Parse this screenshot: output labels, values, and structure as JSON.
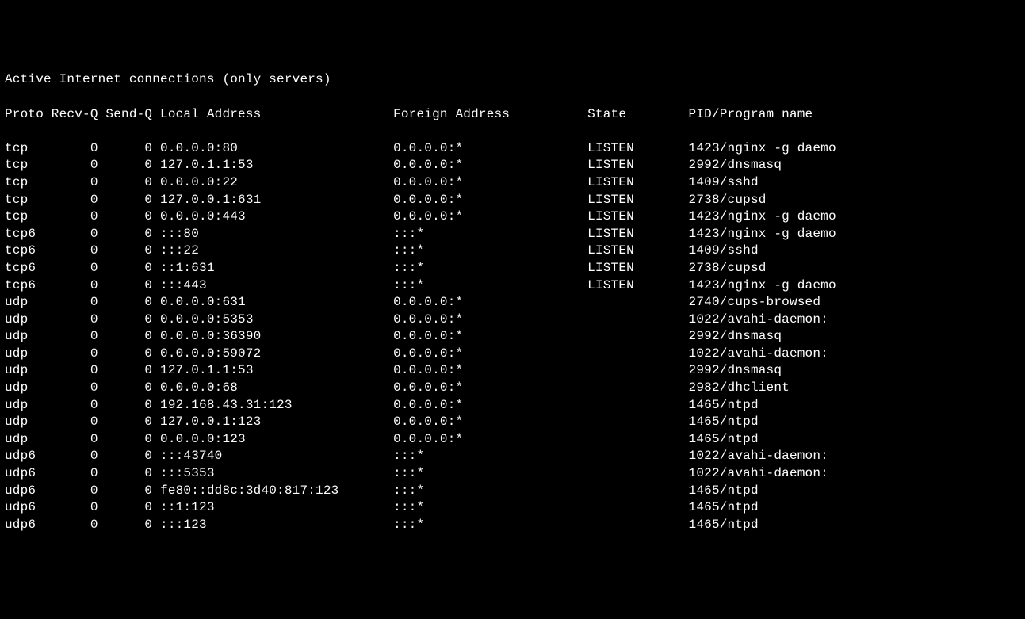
{
  "title": "Active Internet connections (only servers)",
  "headers": {
    "proto": "Proto",
    "recvq": "Recv-Q",
    "sendq": "Send-Q",
    "local": "Local Address",
    "foreign": "Foreign Address",
    "state": "State",
    "pid": "PID/Program name"
  },
  "rows": [
    {
      "proto": "tcp",
      "recvq": "0",
      "sendq": "0",
      "local": "0.0.0.0:80",
      "foreign": "0.0.0.0:*",
      "state": "LISTEN",
      "pid": "1423/nginx -g daemo"
    },
    {
      "proto": "tcp",
      "recvq": "0",
      "sendq": "0",
      "local": "127.0.1.1:53",
      "foreign": "0.0.0.0:*",
      "state": "LISTEN",
      "pid": "2992/dnsmasq"
    },
    {
      "proto": "tcp",
      "recvq": "0",
      "sendq": "0",
      "local": "0.0.0.0:22",
      "foreign": "0.0.0.0:*",
      "state": "LISTEN",
      "pid": "1409/sshd"
    },
    {
      "proto": "tcp",
      "recvq": "0",
      "sendq": "0",
      "local": "127.0.0.1:631",
      "foreign": "0.0.0.0:*",
      "state": "LISTEN",
      "pid": "2738/cupsd"
    },
    {
      "proto": "tcp",
      "recvq": "0",
      "sendq": "0",
      "local": "0.0.0.0:443",
      "foreign": "0.0.0.0:*",
      "state": "LISTEN",
      "pid": "1423/nginx -g daemo"
    },
    {
      "proto": "tcp6",
      "recvq": "0",
      "sendq": "0",
      "local": ":::80",
      "foreign": ":::*",
      "state": "LISTEN",
      "pid": "1423/nginx -g daemo"
    },
    {
      "proto": "tcp6",
      "recvq": "0",
      "sendq": "0",
      "local": ":::22",
      "foreign": ":::*",
      "state": "LISTEN",
      "pid": "1409/sshd"
    },
    {
      "proto": "tcp6",
      "recvq": "0",
      "sendq": "0",
      "local": "::1:631",
      "foreign": ":::*",
      "state": "LISTEN",
      "pid": "2738/cupsd"
    },
    {
      "proto": "tcp6",
      "recvq": "0",
      "sendq": "0",
      "local": ":::443",
      "foreign": ":::*",
      "state": "LISTEN",
      "pid": "1423/nginx -g daemo"
    },
    {
      "proto": "udp",
      "recvq": "0",
      "sendq": "0",
      "local": "0.0.0.0:631",
      "foreign": "0.0.0.0:*",
      "state": "",
      "pid": "2740/cups-browsed"
    },
    {
      "proto": "udp",
      "recvq": "0",
      "sendq": "0",
      "local": "0.0.0.0:5353",
      "foreign": "0.0.0.0:*",
      "state": "",
      "pid": "1022/avahi-daemon:"
    },
    {
      "proto": "udp",
      "recvq": "0",
      "sendq": "0",
      "local": "0.0.0.0:36390",
      "foreign": "0.0.0.0:*",
      "state": "",
      "pid": "2992/dnsmasq"
    },
    {
      "proto": "udp",
      "recvq": "0",
      "sendq": "0",
      "local": "0.0.0.0:59072",
      "foreign": "0.0.0.0:*",
      "state": "",
      "pid": "1022/avahi-daemon:"
    },
    {
      "proto": "udp",
      "recvq": "0",
      "sendq": "0",
      "local": "127.0.1.1:53",
      "foreign": "0.0.0.0:*",
      "state": "",
      "pid": "2992/dnsmasq"
    },
    {
      "proto": "udp",
      "recvq": "0",
      "sendq": "0",
      "local": "0.0.0.0:68",
      "foreign": "0.0.0.0:*",
      "state": "",
      "pid": "2982/dhclient"
    },
    {
      "proto": "udp",
      "recvq": "0",
      "sendq": "0",
      "local": "192.168.43.31:123",
      "foreign": "0.0.0.0:*",
      "state": "",
      "pid": "1465/ntpd"
    },
    {
      "proto": "udp",
      "recvq": "0",
      "sendq": "0",
      "local": "127.0.0.1:123",
      "foreign": "0.0.0.0:*",
      "state": "",
      "pid": "1465/ntpd"
    },
    {
      "proto": "udp",
      "recvq": "0",
      "sendq": "0",
      "local": "0.0.0.0:123",
      "foreign": "0.0.0.0:*",
      "state": "",
      "pid": "1465/ntpd"
    },
    {
      "proto": "udp6",
      "recvq": "0",
      "sendq": "0",
      "local": ":::43740",
      "foreign": ":::*",
      "state": "",
      "pid": "1022/avahi-daemon:"
    },
    {
      "proto": "udp6",
      "recvq": "0",
      "sendq": "0",
      "local": ":::5353",
      "foreign": ":::*",
      "state": "",
      "pid": "1022/avahi-daemon:"
    },
    {
      "proto": "udp6",
      "recvq": "0",
      "sendq": "0",
      "local": "fe80::dd8c:3d40:817:123",
      "foreign": ":::*",
      "state": "",
      "pid": "1465/ntpd"
    },
    {
      "proto": "udp6",
      "recvq": "0",
      "sendq": "0",
      "local": "::1:123",
      "foreign": ":::*",
      "state": "",
      "pid": "1465/ntpd"
    },
    {
      "proto": "udp6",
      "recvq": "0",
      "sendq": "0",
      "local": ":::123",
      "foreign": ":::*",
      "state": "",
      "pid": "1465/ntpd"
    }
  ]
}
